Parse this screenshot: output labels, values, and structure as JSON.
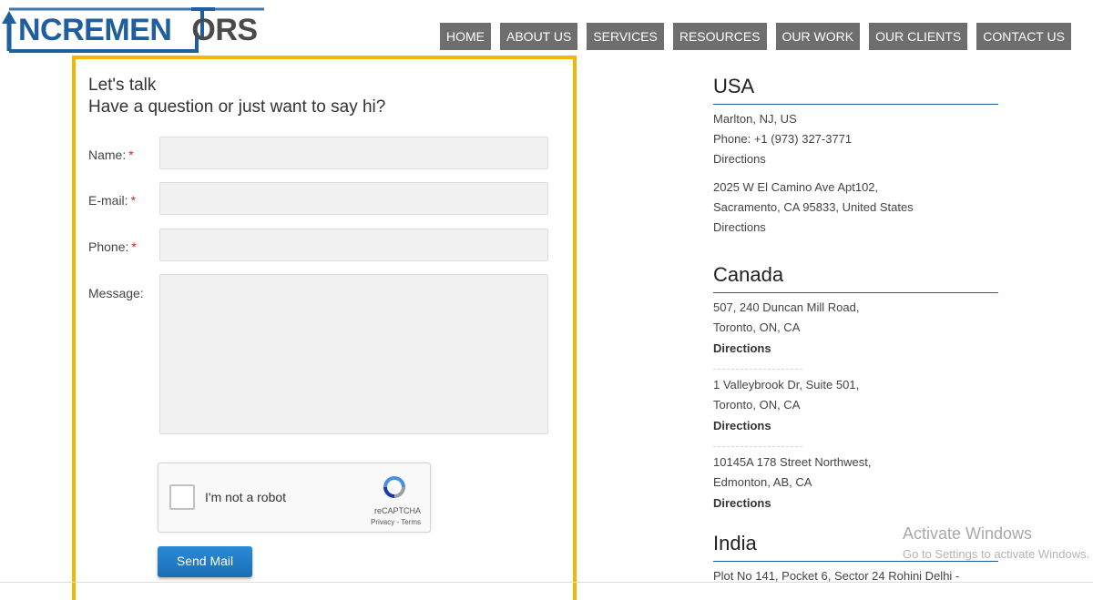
{
  "header": {
    "logo": {
      "part1": "NCREMEN",
      "part2": "ORS"
    },
    "nav": [
      "HOME",
      "ABOUT US",
      "SERVICES",
      "RESOURCES",
      "OUR WORK",
      "OUR CLIENTS",
      "CONTACT US"
    ]
  },
  "form": {
    "title": "Let's talk",
    "subtitle": "Have a question or just want to say hi?",
    "fields": {
      "name_label": "Name:",
      "email_label": "E-mail:",
      "phone_label": "Phone:",
      "message_label": "Message:",
      "required_mark": "*",
      "name_value": "",
      "email_value": "",
      "phone_value": "",
      "message_value": ""
    },
    "captcha": {
      "label": "I'm not a robot",
      "brand": "reCAPTCHA",
      "links": "Privacy - Terms"
    },
    "submit_label": "Send Mail"
  },
  "locations": {
    "usa": {
      "heading": "USA",
      "office1": {
        "line1": "Marlton, NJ, US",
        "line2": "Phone: +1 (973) 327-3771",
        "directions": "Directions"
      },
      "office2": {
        "line1": "2025 W El Camino Ave Apt102,",
        "line2": "Sacramento, CA 95833, United States",
        "directions": "Directions"
      }
    },
    "canada": {
      "heading": "Canada",
      "office1": {
        "line1": "507, 240 Duncan Mill Road,",
        "line2": "Toronto, ON, CA",
        "directions": "Directions"
      },
      "office2": {
        "line1": "1 Valleybrook Dr, Suite 501,",
        "line2": "Toronto, ON, CA",
        "directions": "Directions"
      },
      "office3": {
        "line1": "10145A 178 Street Northwest,",
        "line2": "Edmonton, AB, CA",
        "directions": "Directions"
      }
    },
    "india": {
      "heading": "India",
      "office1": {
        "line1": "Plot No 141, Pocket 6, Sector 24 Rohini Delhi -"
      }
    }
  },
  "watermark": {
    "line1": "Activate Windows",
    "line2": "Go to Settings to activate Windows."
  },
  "colors": {
    "brand_blue": "#1f5f9e",
    "nav_bg": "#6e6e6e",
    "card_border": "#f2b705",
    "button_blue": "#1a6fb5",
    "required": "#e02020"
  }
}
